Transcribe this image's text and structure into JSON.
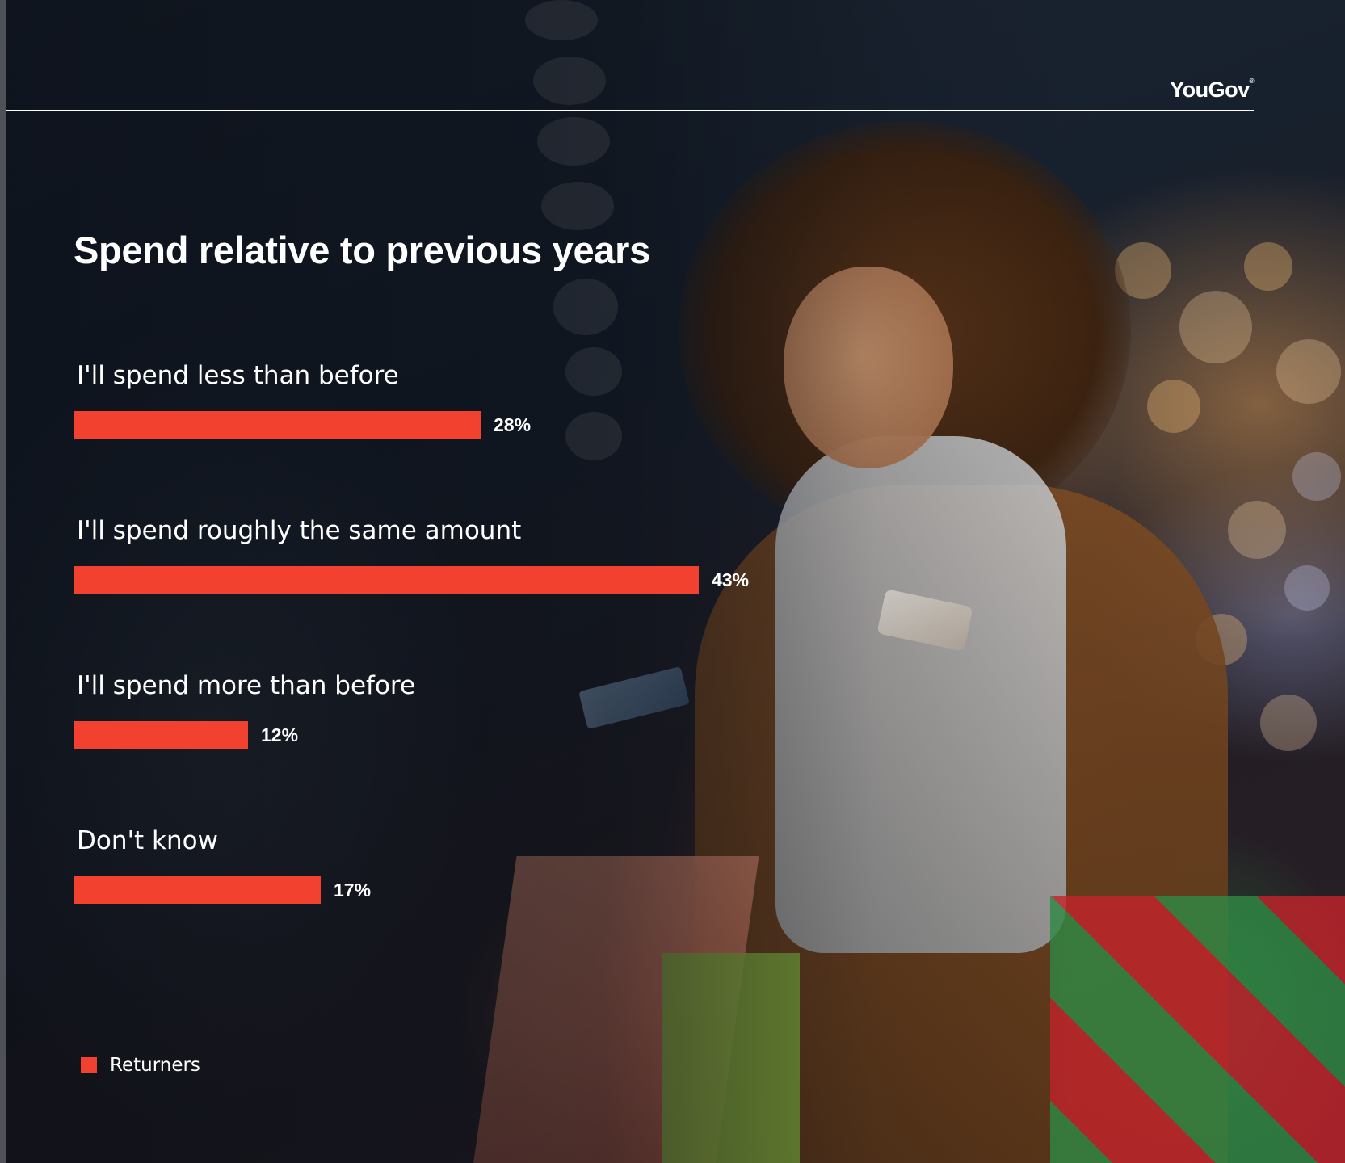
{
  "brand": {
    "name": "YouGov"
  },
  "chart_data": {
    "type": "bar",
    "orientation": "horizontal",
    "title": "Spend relative to previous years",
    "categories": [
      "I'll spend less than before",
      "I'll spend roughly the same amount",
      "I'll spend more than before",
      "Don't know"
    ],
    "series": [
      {
        "name": "Returners",
        "values": [
          28,
          43,
          12,
          17
        ],
        "color": "#f2412f"
      }
    ],
    "value_suffix": "%",
    "xlim": [
      0,
      43
    ],
    "grid": false,
    "legend_position": "bottom-left"
  },
  "background": {
    "description_icon": "photo-shopper-with-bags"
  }
}
